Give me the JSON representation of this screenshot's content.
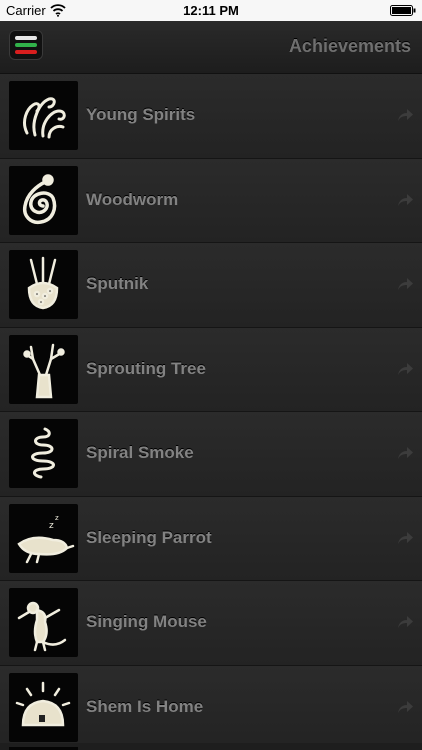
{
  "status_bar": {
    "carrier": "Carrier",
    "time": "12:11 PM",
    "wifi_icon": "wifi-icon",
    "battery_icon": "battery-icon"
  },
  "nav_bar": {
    "title": "Achievements",
    "menu_icon": "hamburger-menu-icon",
    "menu_colors": [
      "#e9e9e9",
      "#31b24a",
      "#d81e1e"
    ]
  },
  "achievements": [
    {
      "label": "Young Spirits",
      "icon": "spirits-icon"
    },
    {
      "label": "Woodworm",
      "icon": "worm-icon"
    },
    {
      "label": "Sputnik",
      "icon": "sputnik-icon"
    },
    {
      "label": "Sprouting Tree",
      "icon": "tree-icon"
    },
    {
      "label": "Spiral Smoke",
      "icon": "smoke-icon"
    },
    {
      "label": "Sleeping Parrot",
      "icon": "parrot-icon"
    },
    {
      "label": "Singing Mouse",
      "icon": "mouse-icon"
    },
    {
      "label": "Shem Is Home",
      "icon": "home-icon"
    }
  ],
  "row_action_icon": "share-arrow-icon"
}
